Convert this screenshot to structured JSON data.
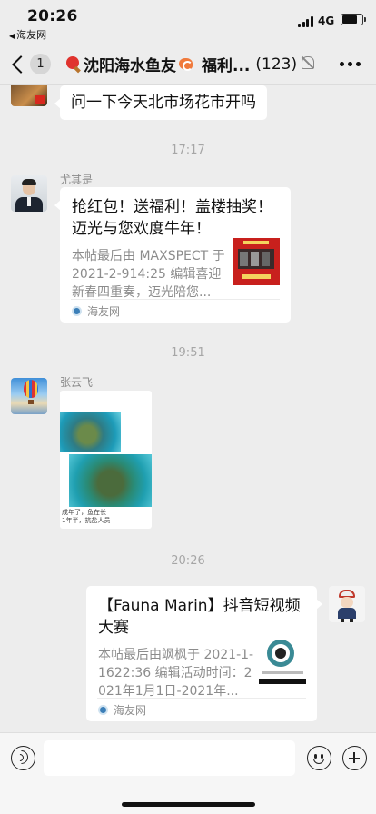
{
  "status_bar": {
    "time": "20:26",
    "back_app": "海友网",
    "network": "4G"
  },
  "nav": {
    "unread_count": "1",
    "title_part1": "沈阳海水鱼友",
    "title_part2": "福利...",
    "member_count": "(123)",
    "title_icons": [
      "ping-pong-paddle-icon",
      "shrimp-icon"
    ]
  },
  "messages": {
    "msg1": {
      "text": "问一下今天北市场花市开吗"
    },
    "time1": "17:17",
    "msg2": {
      "sender": "尤其是",
      "card_title": "抢红包！送福利！盖楼抽奖！迈光与您欢度牛年！",
      "card_desc": "本帖最后由 MAXSPECT 于 2021-2-914:25 编辑喜迎新春四重奏，迈光陪您...",
      "source": "海友网"
    },
    "time2": "19:51",
    "msg3": {
      "sender": "张云飞",
      "caption_line1": "成年了，鱼在长",
      "caption_line2": "1年半，抗盐人员"
    },
    "time3": "20:26",
    "msg4": {
      "card_title": "【Fauna Marin】抖音短视频大赛",
      "card_desc": "本帖最后由飒枫于 2021-1-1622:36 编辑活动时间：2021年1月1日-2021年...",
      "source": "海友网"
    }
  },
  "colors": {
    "background": "#ededed",
    "bubble": "#ffffff",
    "muted_text": "#8c8c8c"
  }
}
